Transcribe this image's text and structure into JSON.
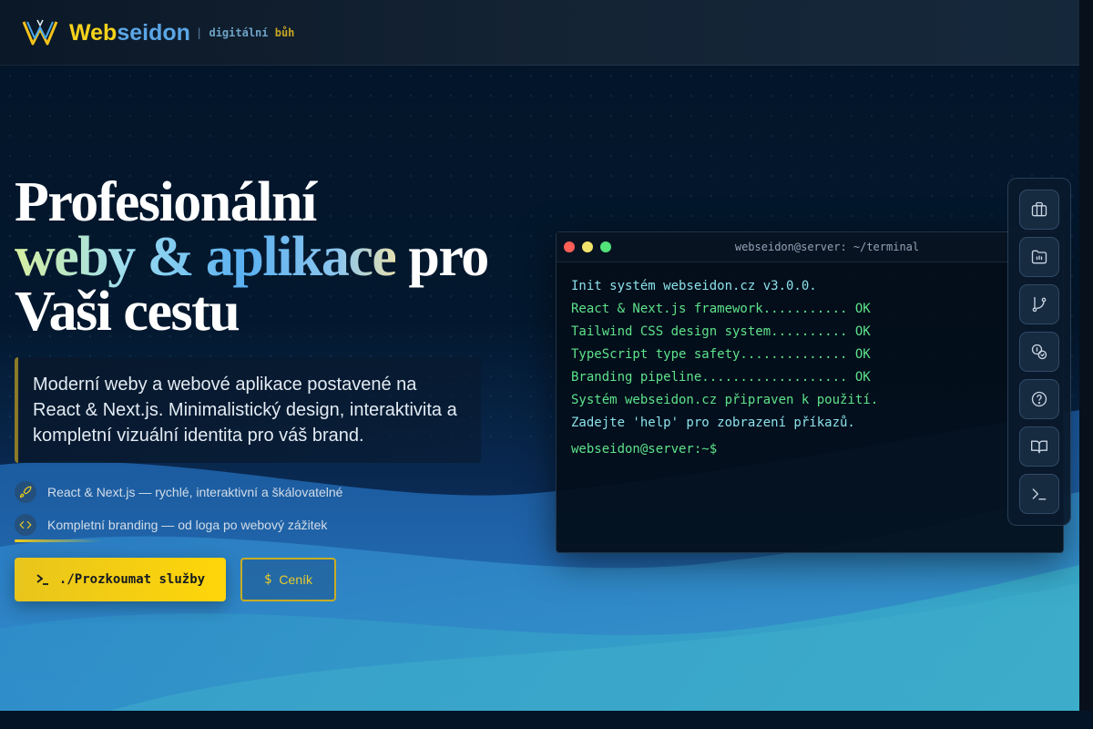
{
  "navbar": {
    "brand_web": "Web",
    "brand_seidon": "seidon",
    "tagline_sep": "|",
    "tagline_a": "digitální",
    "tagline_b": "bůh",
    "logo_icon": "webseidon-logo-icon"
  },
  "hero": {
    "title_line1": "Profesionální",
    "title_grad": "weby & aplikace",
    "title_pro": " pro",
    "title_line3": "Vaši cestu",
    "lead": "Moderní weby a webové aplikace postavené na React & Next.js. Minimalistický design, interaktivita a kompletní vizuální identita pro váš brand.",
    "features": [
      {
        "icon": "rocket-icon",
        "text": "React & Next.js — rychlé, interaktivní a škálovatelné"
      },
      {
        "icon": "code-icon",
        "text": "Kompletní branding — od loga po webový zážitek"
      }
    ],
    "primary_button": "./Prozkoumat služby",
    "secondary_dollar": "$",
    "secondary_button": "Ceník"
  },
  "terminal": {
    "title": "webseidon@server: ~/terminal",
    "lines": [
      "Init systém webseidon.cz v3.0.0.",
      "React & Next.js framework........... OK",
      "Tailwind CSS design system.......... OK",
      "TypeScript type safety.............. OK",
      "Branding pipeline................... OK",
      "Systém webseidon.cz připraven k použití.",
      "Zadejte 'help' pro zobrazení příkazů."
    ],
    "prompt": "webseidon@server:~$"
  },
  "tools": [
    {
      "icon": "briefcase-icon"
    },
    {
      "icon": "folder-icon"
    },
    {
      "icon": "git-branch-icon"
    },
    {
      "icon": "coins-icon"
    },
    {
      "icon": "help-circle-icon"
    },
    {
      "icon": "book-open-icon"
    },
    {
      "icon": "terminal-icon"
    }
  ],
  "colors": {
    "accent_yellow": "#ffd60a",
    "accent_blue": "#5aa6e6",
    "terminal_green": "#5ee28a",
    "terminal_cyan": "#8be1ea"
  }
}
